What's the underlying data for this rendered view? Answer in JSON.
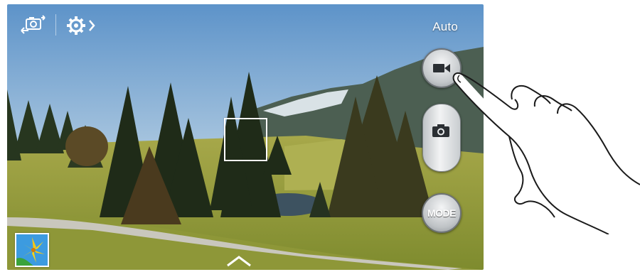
{
  "viewfinder": {
    "scene": "mountain-landscape-with-trees-and-lake"
  },
  "top_bar": {
    "switch_camera_icon": "switch-camera-icon",
    "settings_icon": "settings-gear-icon",
    "flash_mode_label": "Auto"
  },
  "controls": {
    "record_icon": "video-camera-icon",
    "capture_icon": "photo-camera-icon",
    "mode_label": "MODE"
  },
  "bottom": {
    "gallery_icon": "gallery-thumbnail",
    "expand_icon": "chevron-up-icon"
  },
  "colors": {
    "button_silver": "#c3c7ca",
    "icon_dark": "#2b2f33",
    "label_white": "#ffffff"
  }
}
